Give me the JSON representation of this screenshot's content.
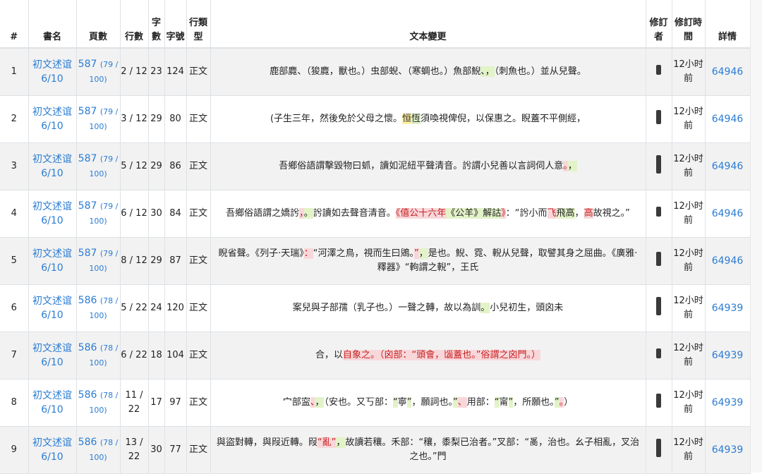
{
  "headers": {
    "num": "#",
    "book": "書名",
    "page": "頁數",
    "line": "行數",
    "char_count": "字數",
    "char_no": "字號",
    "line_type": "行類型",
    "change": "文本變更",
    "editor": "修訂者",
    "time": "修訂時間",
    "detail": "詳情"
  },
  "rows": [
    {
      "num": "1",
      "book": "初文述谊 6/10",
      "page": "587",
      "page_sub": "(79 / 100)",
      "line": "2 / 12",
      "chars": "23",
      "charno": "124",
      "ltype": "正文",
      "time": "12小时前",
      "detail": "64946",
      "segs": [
        {
          "t": "鹿部麑、（狻麑，獸也。）虫部蜺、（寒蜩也。）魚部鯢"
        },
        {
          "t": "、，",
          "h": "g"
        },
        {
          "t": "（刺魚也。）並从兒聲。"
        }
      ]
    },
    {
      "num": "2",
      "book": "初文述谊 6/10",
      "page": "587",
      "page_sub": "(79 / 100)",
      "line": "3 / 12",
      "chars": "29",
      "charno": "80",
      "ltype": "正文",
      "time": "12小时前",
      "detail": "64946",
      "segs": [
        {
          "t": "(子生三年，然後免於父母之懷。"
        },
        {
          "t": "恒",
          "h": "y"
        },
        {
          "t": "恆",
          "h": "g"
        },
        {
          "t": "須喚視俾倪，以保惠之。睨蓋不平側經，"
        }
      ]
    },
    {
      "num": "3",
      "book": "初文述谊 6/10",
      "page": "587",
      "page_sub": "(79 / 100)",
      "line": "5 / 12",
      "chars": "29",
      "charno": "86",
      "ltype": "正文",
      "time": "12小时前",
      "detail": "64946",
      "segs": [
        {
          "t": "吾鄉俗語謂擊毀物曰䖣，讀如泥紐平聲清音。䚷謂小兒善以言詞伺人意"
        },
        {
          "t": "。",
          "h": "r"
        },
        {
          "t": "，",
          "h": "g"
        }
      ]
    },
    {
      "num": "4",
      "book": "初文述谊 6/10",
      "page": "587",
      "page_sub": "(79 / 100)",
      "line": "6 / 12",
      "chars": "30",
      "charno": "84",
      "ltype": "正文",
      "time": "12小时前",
      "detail": "64946",
      "segs": [
        {
          "t": "吾鄉俗語謂之嬌䚷"
        },
        {
          "t": "，",
          "h": "r"
        },
        {
          "t": "。",
          "h": "g"
        },
        {
          "t": "䚷讀如去聲音清音。"
        },
        {
          "t": "《僖公十六年",
          "h": "r"
        },
        {
          "t": "《公羊》解詁",
          "h": "g"
        },
        {
          "t": "》",
          "h": "r"
        },
        {
          "t": "：“䚷小而"
        },
        {
          "t": "飞",
          "h": "r"
        },
        {
          "t": "飛高",
          "h": "g"
        },
        {
          "t": "，"
        },
        {
          "t": "高",
          "h": "r"
        },
        {
          "t": "故視之。”"
        }
      ]
    },
    {
      "num": "5",
      "book": "初文述谊 6/10",
      "page": "587",
      "page_sub": "(79 / 100)",
      "line": "8 / 12",
      "chars": "29",
      "charno": "87",
      "ltype": "正文",
      "time": "12小时前",
      "detail": "64946",
      "segs": [
        {
          "t": "睨省聲。《列子·天瑞》"
        },
        {
          "t": "：",
          "h": "r"
        },
        {
          "t": "“河澤之鳥，視而生曰鶂。"
        },
        {
          "t": "”",
          "h": "r"
        },
        {
          "t": "，",
          "h": "g"
        },
        {
          "t": "是也。鯢、霓、輗从兒聲，取譬其身之屈曲。《廣雅·釋器》“軥謂之輗”，王氏"
        }
      ]
    },
    {
      "num": "6",
      "book": "初文述谊 6/10",
      "page": "586",
      "page_sub": "(78 / 100)",
      "line": "5 / 22",
      "chars": "24",
      "charno": "120",
      "ltype": "正文",
      "time": "12小时前",
      "detail": "64939",
      "segs": [
        {
          "t": "案兒與子部孺（乳子也。）一聲之轉，故以為訓"
        },
        {
          "t": "。",
          "h": "g"
        },
        {
          "t": "小兒初生，頭囟未"
        }
      ]
    },
    {
      "num": "7",
      "book": "初文述谊 6/10",
      "page": "586",
      "page_sub": "(78 / 100)",
      "line": "6 / 22",
      "chars": "18",
      "charno": "104",
      "ltype": "正文",
      "time": "12小时前",
      "detail": "64939",
      "segs": [
        {
          "t": "合，以"
        },
        {
          "t": "自象之。（囟部：“頭會，匘蓋也。”俗謂之囟門。）",
          "h": "r"
        }
      ]
    },
    {
      "num": "8",
      "book": "初文述谊 6/10",
      "page": "586",
      "page_sub": "(78 / 100)",
      "line": "11 / 22",
      "chars": "17",
      "charno": "97",
      "ltype": "正文",
      "time": "12小时前",
      "detail": "64939",
      "segs": [
        {
          "t": "宀部寍"
        },
        {
          "t": "、",
          "h": "r"
        },
        {
          "t": "，",
          "h": "g"
        },
        {
          "t": "（安也。又丂部："
        },
        {
          "t": "“",
          "h": "g"
        },
        {
          "t": "寧"
        },
        {
          "t": "”",
          "h": "g"
        },
        {
          "t": "，願詞也。"
        },
        {
          "t": "”",
          "h": "g"
        },
        {
          "t": "、",
          "h": "r"
        },
        {
          "t": "用部："
        },
        {
          "t": "“",
          "h": "g"
        },
        {
          "t": "甯"
        },
        {
          "t": "”",
          "h": "g"
        },
        {
          "t": "，所願也。"
        },
        {
          "t": "”",
          "h": "g"
        },
        {
          "t": "。",
          "h": "r"
        },
        {
          "t": "）"
        }
      ]
    },
    {
      "num": "9",
      "book": "初文述谊 6/10",
      "page": "586",
      "page_sub": "(78 / 100)",
      "line": "13 / 22",
      "chars": "30",
      "charno": "77",
      "ltype": "正文",
      "time": "12小时前",
      "detail": "64939",
      "segs": [
        {
          "t": "與盜對轉，與叚近轉。叚"
        },
        {
          "t": "“亂”",
          "h": "r"
        },
        {
          "t": "，",
          "h": "g"
        },
        {
          "t": "故讀若穰。禾部：“穰，黍梨已治者。”叉部：“𤔔，治也。幺子相亂，叉治之也。”門"
        }
      ]
    }
  ]
}
